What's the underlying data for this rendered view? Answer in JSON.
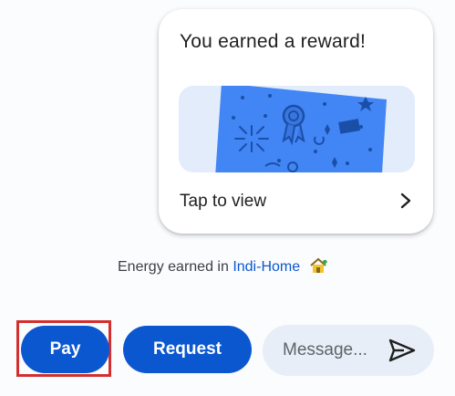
{
  "reward_card": {
    "title": "You earned a reward!",
    "tap_label": "Tap to view",
    "card_color": "#4285f4",
    "banner_color": "#e3ecfb"
  },
  "energy": {
    "prefix": "Energy earned in",
    "link_text": "Indi-Home",
    "icon": "house-icon"
  },
  "actions": {
    "pay_label": "Pay",
    "request_label": "Request",
    "message_placeholder": "Message...",
    "send_icon": "send-icon"
  },
  "colors": {
    "accent": "#0b57d0",
    "highlight_border": "#d32f2f"
  }
}
